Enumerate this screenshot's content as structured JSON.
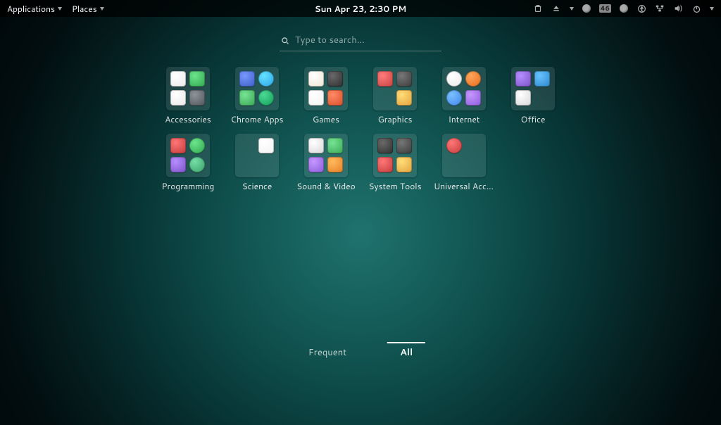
{
  "topbar": {
    "menus": [
      "Applications",
      "Places"
    ],
    "datetime": "Sun Apr 23,  2:30 PM",
    "battery_badge": "46",
    "tray": [
      "trash-icon",
      "eject-icon",
      "caret-icon",
      "weather-icon",
      "battery-icon",
      "user-icon",
      "accessibility-icon",
      "network-icon",
      "volume-icon",
      "power-icon"
    ]
  },
  "search": {
    "placeholder": "Type to search…"
  },
  "apps": [
    {
      "label": "Accessories",
      "swatches": [
        "#e8e8e8",
        "#2fa84f",
        "#e8e8e8",
        "#51555c"
      ]
    },
    {
      "label": "Chrome Apps",
      "swatches": [
        "#3b5cc4",
        "#29a4e8",
        "#3aa757",
        "#0f9d58"
      ],
      "round": [
        false,
        true,
        false,
        true
      ]
    },
    {
      "label": "Games",
      "swatches": [
        "#f0e6d2",
        "#2d2d2d",
        "#f1f1f1",
        "#d84e2a"
      ]
    },
    {
      "label": "Graphics",
      "swatches": [
        "#c64040",
        "#3b3b3b",
        "",
        "#e2a13c"
      ]
    },
    {
      "label": "Internet",
      "swatches": [
        "#e8e8e8",
        "#e66a1e",
        "#3e84e8",
        "#8a5bd8"
      ],
      "round": [
        true,
        true,
        true,
        false
      ]
    },
    {
      "label": "Office",
      "swatches": [
        "#7b52c7",
        "#2b87c9",
        "#d6d6d6",
        ""
      ]
    },
    {
      "label": "Programming",
      "swatches": [
        "#c23a3a",
        "#2fa84f",
        "#7b52c7",
        "#38a169"
      ],
      "round": [
        false,
        true,
        false,
        true
      ]
    },
    {
      "label": "Science",
      "swatches": [
        "",
        "#f2f2f2",
        "",
        ""
      ]
    },
    {
      "label": "Sound & Video",
      "swatches": [
        "#d6d6d6",
        "#3aa757",
        "#8a5bd8",
        "#e67e22"
      ]
    },
    {
      "label": "System Tools",
      "swatches": [
        "#2e2e2e",
        "#3a3a3a",
        "#c23a3a",
        "#e2a13c"
      ]
    },
    {
      "label": "Universal Access",
      "swatches": [
        "#c23a3a",
        "",
        "",
        ""
      ],
      "round": [
        true,
        false,
        false,
        false
      ]
    }
  ],
  "dash": {
    "tabs": [
      "Frequent",
      "All"
    ],
    "active": "All"
  }
}
